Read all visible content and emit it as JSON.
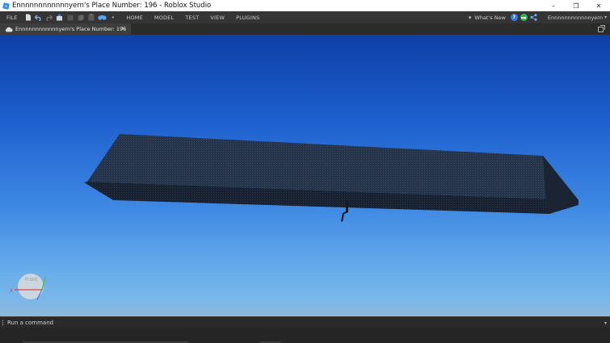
{
  "window": {
    "title": "Ennnnnnnnnnnnyern's Place Number: 196 - Roblox Studio",
    "minimize_glyph": "–",
    "restore_glyph": "❐",
    "close_glyph": "✕"
  },
  "menubar": {
    "file_label": "FILE",
    "tabs": [
      "HOME",
      "MODEL",
      "TEST",
      "VIEW",
      "PLUGINS"
    ],
    "whats_new_label": "What's New",
    "username": "Ennnnnnnnnnnnyern",
    "help_glyph": "?"
  },
  "document_tab": {
    "label": "Ennnnnnnnnnnnyern's Place Number: 196",
    "close_glyph": "✕"
  },
  "viewcube": {
    "face_label": "Front",
    "axis_label": "X"
  },
  "command_bar": {
    "placeholder": "Run a command",
    "dropdown_glyph": "▾"
  },
  "colors": {
    "sky_top": "#0f3fa6",
    "sky_bottom": "#86bde9",
    "part_top": "#2b3b52",
    "part_front": "#1b2534",
    "chrome_dark": "#353535"
  }
}
